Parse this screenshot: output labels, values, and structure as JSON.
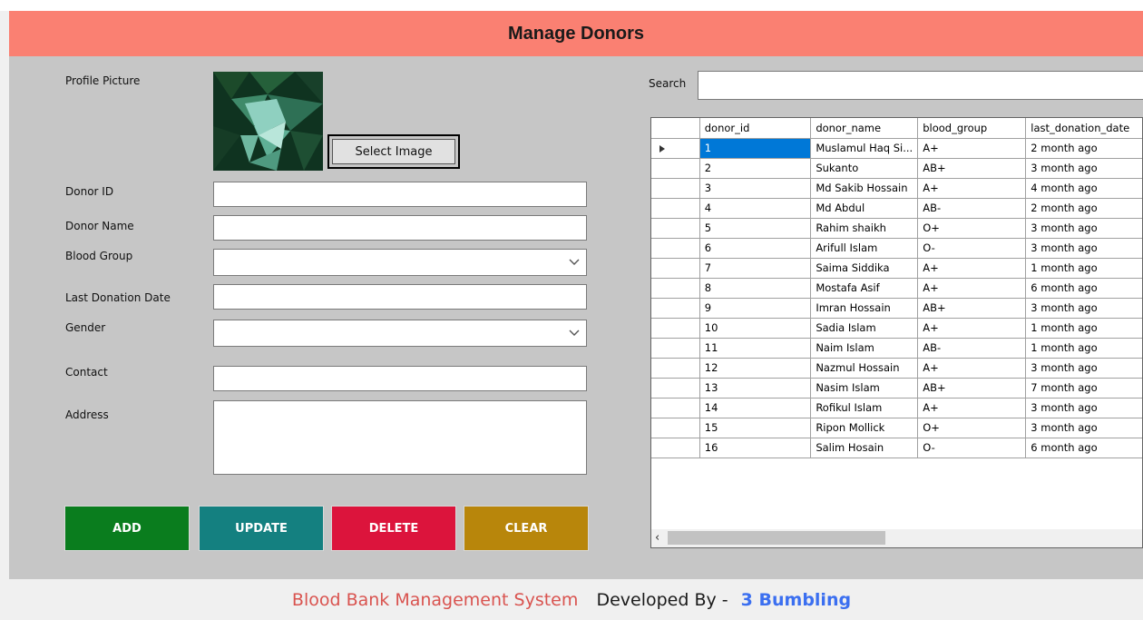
{
  "header": {
    "title": "Manage Donors"
  },
  "form": {
    "profile_picture_label": "Profile Picture",
    "select_image_label": "Select Image",
    "donor_id_label": "Donor ID",
    "donor_name_label": "Donor Name",
    "blood_group_label": "Blood Group",
    "last_donation_label": "Last Donation Date",
    "gender_label": "Gender",
    "contact_label": "Contact",
    "address_label": "Address",
    "donor_id_value": "",
    "donor_name_value": "",
    "blood_group_value": "",
    "last_donation_value": "",
    "gender_value": "",
    "contact_value": "",
    "address_value": ""
  },
  "actions": {
    "add": "ADD",
    "update": "UPDATE",
    "delete": "DELETE",
    "clear": "CLEAR",
    "colors": {
      "add": "#0a7d1e",
      "update": "#148080",
      "delete": "#dc143c",
      "clear": "#b8860b"
    }
  },
  "search": {
    "label": "Search",
    "value": ""
  },
  "grid": {
    "columns": [
      "donor_id",
      "donor_name",
      "blood_group",
      "last_donation_date"
    ],
    "rows": [
      [
        "1",
        "Muslamul Haq Si...",
        "A+",
        "2 month ago"
      ],
      [
        "2",
        "Sukanto",
        "AB+",
        "3 month ago"
      ],
      [
        "3",
        "Md Sakib Hossain",
        "A+",
        "4 month ago"
      ],
      [
        "4",
        "Md Abdul",
        "AB-",
        "2 month ago"
      ],
      [
        "5",
        "Rahim shaikh",
        "O+",
        "3 month ago"
      ],
      [
        "6",
        "Arifull Islam",
        "O-",
        "3 month ago"
      ],
      [
        "7",
        "Saima Siddika",
        "A+",
        "1 month ago"
      ],
      [
        "8",
        "Mostafa Asif",
        "A+",
        "6 month ago"
      ],
      [
        "9",
        "Imran Hossain",
        "AB+",
        "3 month ago"
      ],
      [
        "10",
        "Sadia Islam",
        "A+",
        "1 month ago"
      ],
      [
        "11",
        "Naim Islam",
        "AB-",
        "1 month ago"
      ],
      [
        "12",
        "Nazmul Hossain",
        "A+",
        "3 month ago"
      ],
      [
        "13",
        "Nasim Islam",
        "AB+",
        "7 month ago"
      ],
      [
        "14",
        "Rofikul Islam",
        "A+",
        "3 month ago"
      ],
      [
        "15",
        "Ripon Mollick",
        "O+",
        "3 month ago"
      ],
      [
        "16",
        "Salim Hosain",
        "O-",
        "6 month ago"
      ]
    ],
    "selected_row": 0,
    "scroll_left_icon": "chevron-left-icon"
  },
  "footer": {
    "app_name": "Blood Bank Management System",
    "developed_by": "Developed By -",
    "team": "3 Bumbling"
  }
}
